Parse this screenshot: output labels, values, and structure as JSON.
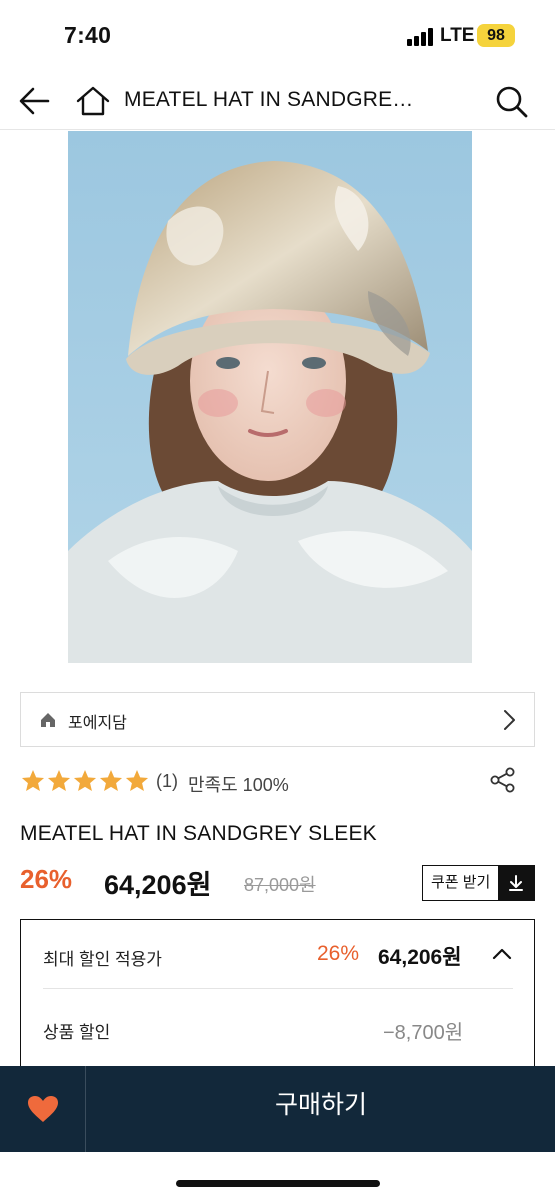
{
  "status": {
    "time": "7:40",
    "network": "LTE",
    "battery": "98"
  },
  "nav": {
    "title": "MEATEL HAT IN SANDGRE…"
  },
  "brand": {
    "name": "포에지담"
  },
  "rating": {
    "stars": 5,
    "review_count": "(1)",
    "satisfaction": "만족도 100%"
  },
  "product": {
    "name": "MEATEL HAT IN SANDGREY SLEEK",
    "discount_rate": "26%",
    "sale_price": "64,206원",
    "original_price": "87,000원",
    "coupon_label": "쿠폰 받기"
  },
  "discount_box": {
    "max_label": "최대 할인 적용가",
    "rate": "26%",
    "price": "64,206원",
    "product_discount_label": "상품 할인",
    "product_discount_amount": "−8,700원"
  },
  "bottom": {
    "buy_label": "구매하기"
  },
  "colors": {
    "accent": "#e8602d",
    "star": "#f2a93b",
    "bottom_bar": "#12283a"
  }
}
